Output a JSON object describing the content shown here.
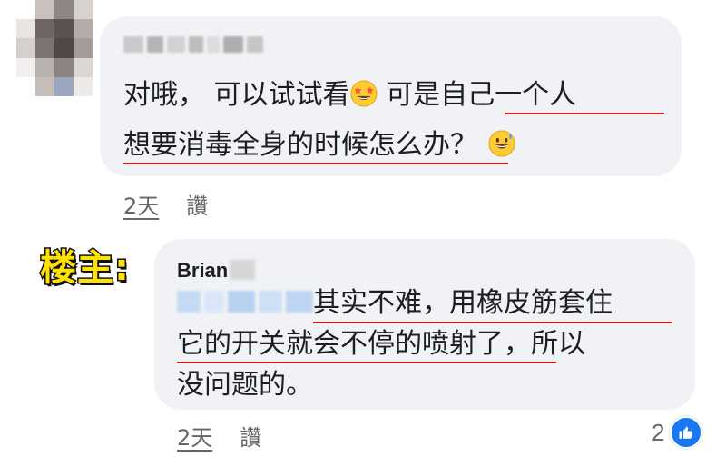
{
  "colors": {
    "bubble": "#f0f2f5",
    "text": "#1c1e21",
    "meta": "#65676b",
    "underline": "#d9141c",
    "op_label_fill": "#ffe100",
    "like_blue": "#1877f2"
  },
  "comment1": {
    "line1_before_emoji": "对哦， 可以试试看",
    "emoji1": "star-struck-emoji",
    "line1_after_emoji": " 可是自己一个人",
    "line2": "想要消毒全身的时候怎么办？",
    "emoji2": "grinning-sweat-emoji",
    "time": "2天",
    "like_label": "讚"
  },
  "op_label": "楼主:",
  "comment2": {
    "author": "Brian",
    "line1": "其实不难，用橡皮筋套住",
    "line2": "它的开关就会不停的喷射了，所以",
    "line3": "没问题的。",
    "time": "2天",
    "like_label": "讚",
    "reaction_count": "2",
    "reaction_icon": "thumbs-up-icon"
  }
}
